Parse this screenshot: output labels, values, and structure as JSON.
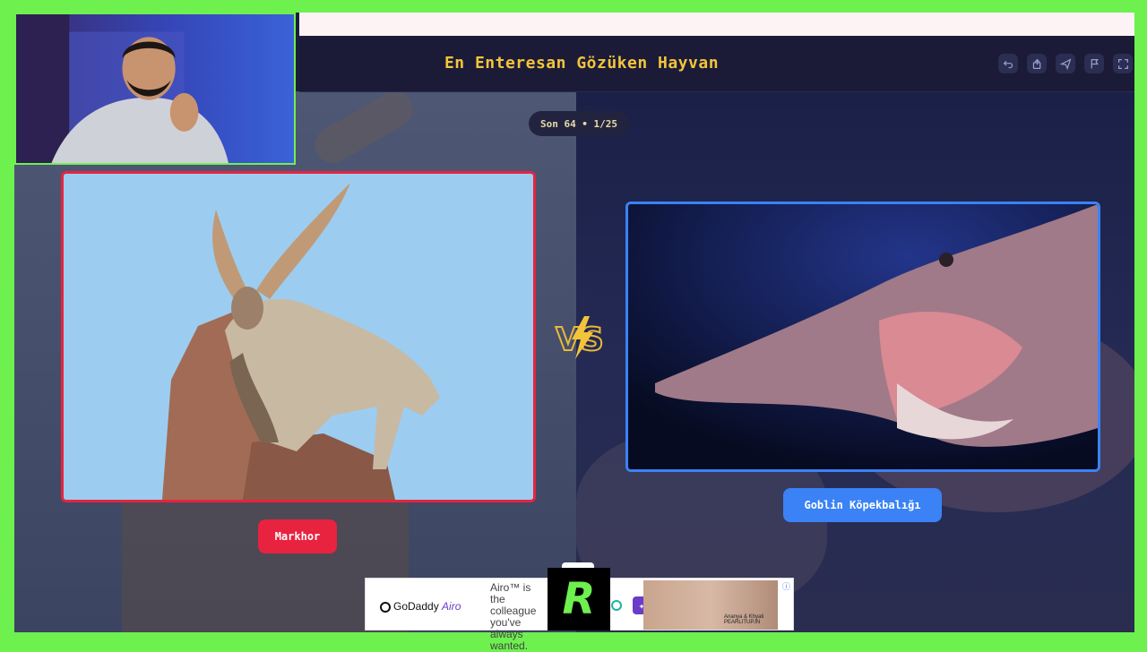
{
  "header": {
    "title": "En Enteresan Gözüken Hayvan",
    "tools": [
      {
        "icon": "undo-icon"
      },
      {
        "icon": "share-icon"
      },
      {
        "icon": "send-icon"
      },
      {
        "icon": "flag-icon"
      },
      {
        "icon": "fullscreen-icon"
      }
    ]
  },
  "round": {
    "label": "Son 64 • 1/25"
  },
  "left_choice": {
    "name": "Markhor",
    "accent": "#e8233f"
  },
  "right_choice": {
    "name": "Goblin Köpekbalığı",
    "accent": "#3a82f5"
  },
  "versus": {
    "icon": "vs-lightning-icon"
  },
  "ad": {
    "brand": "GoDaddy",
    "brand_sub": "Airo",
    "copy": "Airo™ is the colleague you've always wanted.",
    "credit_line1": "Ananya & Khyati",
    "credit_line2": "PEARLITUP.IN"
  },
  "overlay_logo": {
    "letter": "R",
    "color": "#6ef04f"
  },
  "colors": {
    "background": "#6ef04f",
    "appbar": "#1b1b38",
    "title": "#f3c43a"
  }
}
